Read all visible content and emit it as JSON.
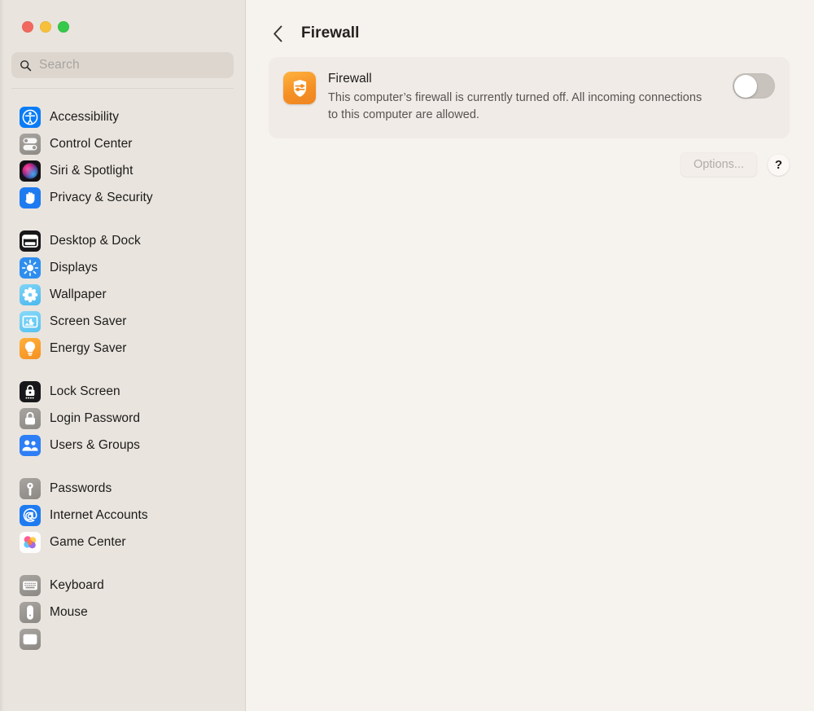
{
  "window": {
    "traffic_lights": [
      {
        "name": "close",
        "color": "#f1695e"
      },
      {
        "name": "minimize",
        "color": "#f7c03a"
      },
      {
        "name": "maximize",
        "color": "#35c84a"
      }
    ]
  },
  "sidebar": {
    "search": {
      "placeholder": "Search",
      "value": "",
      "icon": "search-icon"
    },
    "groups": [
      {
        "items": [
          {
            "label": "Accessibility",
            "icon": "accessibility-icon"
          },
          {
            "label": "Control Center",
            "icon": "control-center-icon"
          },
          {
            "label": "Siri & Spotlight",
            "icon": "siri-icon"
          },
          {
            "label": "Privacy & Security",
            "icon": "privacy-security-icon"
          }
        ]
      },
      {
        "items": [
          {
            "label": "Desktop & Dock",
            "icon": "desktop-dock-icon"
          },
          {
            "label": "Displays",
            "icon": "displays-icon"
          },
          {
            "label": "Wallpaper",
            "icon": "wallpaper-icon"
          },
          {
            "label": "Screen Saver",
            "icon": "screen-saver-icon"
          },
          {
            "label": "Energy Saver",
            "icon": "energy-saver-icon"
          }
        ]
      },
      {
        "items": [
          {
            "label": "Lock Screen",
            "icon": "lock-screen-icon"
          },
          {
            "label": "Login Password",
            "icon": "login-password-icon"
          },
          {
            "label": "Users & Groups",
            "icon": "users-groups-icon"
          }
        ]
      },
      {
        "items": [
          {
            "label": "Passwords",
            "icon": "passwords-icon"
          },
          {
            "label": "Internet Accounts",
            "icon": "internet-accounts-icon"
          },
          {
            "label": "Game Center",
            "icon": "game-center-icon"
          }
        ]
      },
      {
        "items": [
          {
            "label": "Keyboard",
            "icon": "keyboard-icon"
          },
          {
            "label": "Mouse",
            "icon": "mouse-icon"
          }
        ]
      }
    ]
  },
  "main": {
    "back_label": "‹",
    "title": "Firewall",
    "card": {
      "icon": "firewall-icon",
      "title": "Firewall",
      "description": "This computer’s firewall is currently turned off. All incoming connections to this computer are allowed.",
      "toggle": {
        "name": "firewall-toggle",
        "state": "off"
      }
    },
    "options_label": "Options...",
    "help_label": "?"
  },
  "colors": {
    "sidebar_bg": "#e9e4de",
    "main_bg": "#f6f2ee",
    "card_bg": "#f0ebe7",
    "firewall_accent": "#f59025",
    "text_primary": "#1d1b19",
    "text_secondary": "#585451",
    "text_disabled": "#b1aca7"
  }
}
